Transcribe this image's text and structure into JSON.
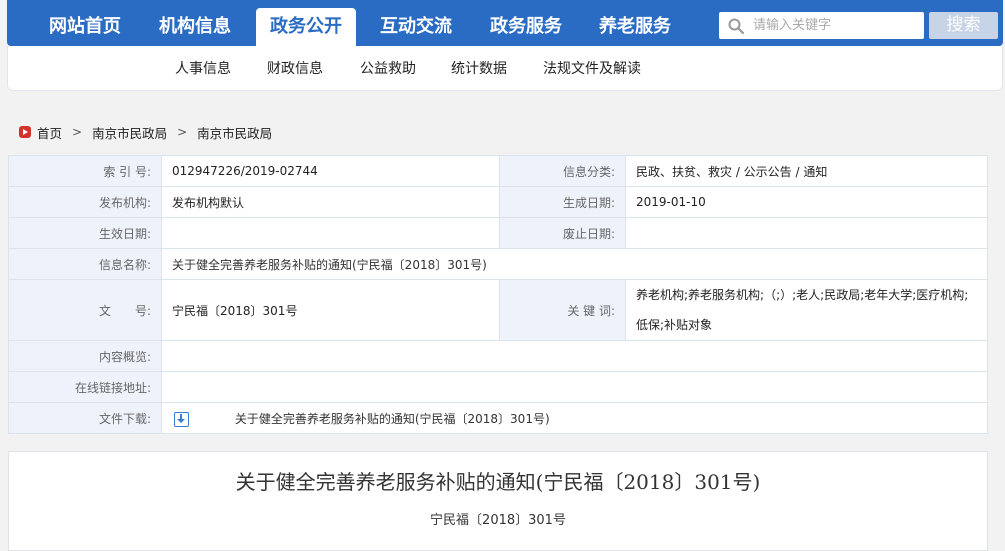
{
  "nav": {
    "items": [
      "网站首页",
      "机构信息",
      "政务公开",
      "互动交流",
      "政务服务",
      "养老服务"
    ],
    "active_index": 2
  },
  "search": {
    "placeholder": "请输入关键字",
    "button_label": "搜索"
  },
  "subnav": {
    "items": [
      "人事信息",
      "财政信息",
      "公益救助",
      "统计数据",
      "法规文件及解读"
    ]
  },
  "breadcrumb": [
    "首页",
    "南京市民政局",
    "南京市民政局"
  ],
  "info": {
    "index_label": "索 引 号:",
    "index_value": "012947226/2019-02744",
    "category_label": "信息分类:",
    "category_value": "民政、扶贫、救灾 / 公示公告 / 通知",
    "publisher_label": "发布机构:",
    "publisher_value": "发布机构默认",
    "created_label": "生成日期:",
    "created_value": "2019-01-10",
    "effective_label": "生效日期:",
    "effective_value": "",
    "abolished_label": "废止日期:",
    "abolished_value": "",
    "name_label": "信息名称:",
    "name_value": "关于健全完善养老服务补贴的通知(宁民福〔2018〕301号)",
    "docno_label": "文　　号:",
    "docno_value": "宁民福〔2018〕301号",
    "keywords_label": "关 键 词:",
    "keywords_value": "养老机构;养老服务机构;（;）;老人;民政局;老年大学;医疗机构;低保;补贴对象",
    "overview_label": "内容概览:",
    "overview_value": "",
    "link_label": "在线链接地址:",
    "link_value": "",
    "download_label": "文件下载:",
    "download_value": "关于健全完善养老服务补贴的通知(宁民福〔2018〕301号)"
  },
  "article": {
    "title": "关于健全完善养老服务补贴的通知(宁民福〔2018〕301号)",
    "subtitle": "宁民福〔2018〕301号"
  },
  "colors": {
    "nav_bg": "#2a6bc4",
    "label_bg": "#eef3fb",
    "border": "#dde3ea"
  }
}
